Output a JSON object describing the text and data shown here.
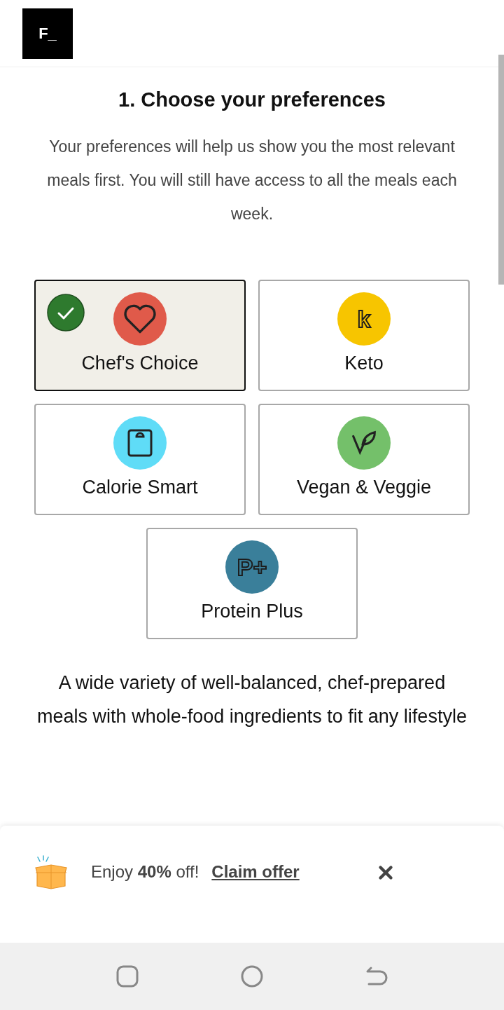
{
  "header": {
    "logo": "F_"
  },
  "title": "1. Choose your preferences",
  "intro": "Your preferences will help us show you the most relevant meals first. You will still have access to all the meals each week.",
  "options": [
    {
      "label": "Chef's Choice",
      "selected": true,
      "kind": "heart",
      "color": "#e05a4a"
    },
    {
      "label": "Keto",
      "selected": false,
      "kind": "letter",
      "glyph": "k",
      "color": "#f7c500"
    },
    {
      "label": "Calorie Smart",
      "selected": false,
      "kind": "scale",
      "color": "#5fdcf7"
    },
    {
      "label": "Vegan & Veggie",
      "selected": false,
      "kind": "leaf",
      "color": "#74c06a"
    },
    {
      "label": "Protein Plus",
      "selected": false,
      "kind": "letter",
      "glyph": "P+",
      "color": "#3a7f9a"
    }
  ],
  "description": "A wide variety of well-balanced, chef-prepared meals with whole-food ingredients to fit any lifestyle",
  "banner": {
    "message": "Enjoy **40%** off!",
    "link": "Claim offer"
  }
}
